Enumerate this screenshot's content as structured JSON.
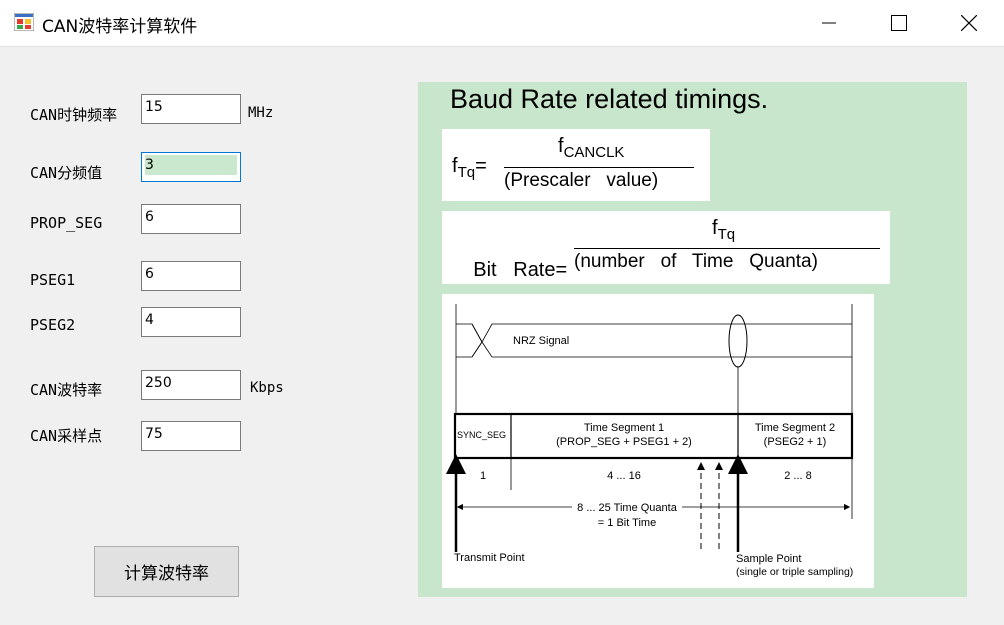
{
  "window": {
    "title": "CAN波特率计算软件"
  },
  "form": {
    "clock_label": "CAN时钟频率",
    "clock_value": "15",
    "clock_unit": "MHz",
    "prescaler_label": "CAN分频值",
    "prescaler_value": "3",
    "prop_seg_label": "PROP_SEG",
    "prop_seg_value": "6",
    "pseg1_label": "PSEG1",
    "pseg1_value": "6",
    "pseg2_label": "PSEG2",
    "pseg2_value": "4",
    "baud_label": "CAN波特率",
    "baud_value": "250",
    "baud_unit": "Kbps",
    "sample_label": "CAN采样点",
    "sample_value": "75",
    "calc_button": "计算波特率"
  },
  "panel": {
    "heading": "Baud Rate related timings.",
    "formula1": {
      "lhs_f": "f",
      "lhs_sub": "Tq",
      "eq": "=",
      "num_f": "f",
      "num_sub": "CANCLK",
      "den": "(Prescaler   value)"
    },
    "formula2": {
      "lhs": "Bit   Rate",
      "eq": "=",
      "num_f": "f",
      "num_sub": "Tq",
      "den": "(number   of   Time   Quanta)"
    },
    "diagram": {
      "nrz": "NRZ Signal",
      "sync_seg": "SYNC_SEG",
      "seg1_title": "Time Segment 1",
      "seg1_formula": "(PROP_SEG + PSEG1 + 2)",
      "seg2_title": "Time Segment 2",
      "seg2_formula": "(PSEG2 + 1)",
      "sync_count": "1",
      "seg1_count": "4 ... 16",
      "seg2_count": "2 ... 8",
      "quanta_line1": "8 ... 25 Time Quanta",
      "quanta_line2": "= 1 Bit Time",
      "transmit_point": "Transmit Point",
      "sample_point": "Sample Point",
      "sample_note": "(single or triple sampling)"
    }
  },
  "colors": {
    "panel_bg": "#c8e6cc",
    "prescaler_highlight": "#c9e8cd",
    "window_bg": "#f0f0f0"
  },
  "icons": [
    "app-icon",
    "minimize-icon",
    "maximize-icon",
    "close-icon"
  ]
}
